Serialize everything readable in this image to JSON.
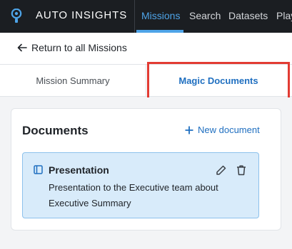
{
  "app": {
    "title": "AUTO INSIGHTS"
  },
  "nav": {
    "items": [
      {
        "label": "Missions",
        "active": true
      },
      {
        "label": "Search",
        "active": false
      },
      {
        "label": "Datasets",
        "active": false
      },
      {
        "label": "Play",
        "active": false
      }
    ]
  },
  "back_link": {
    "label": "Return to all Missions"
  },
  "tabs": [
    {
      "label": "Mission Summary",
      "active": false
    },
    {
      "label": "Magic Documents",
      "active": true
    }
  ],
  "documents": {
    "title": "Documents",
    "new_button": "New document",
    "items": [
      {
        "title": "Presentation",
        "description": "Presentation to the Executive team about Executive Summary"
      }
    ]
  },
  "colors": {
    "nav_bg": "#1b1e22",
    "accent": "#1f6fc0",
    "nav_active": "#4ea4e8",
    "highlight": "#e23b33",
    "doc_bg": "#d8ebfa"
  }
}
